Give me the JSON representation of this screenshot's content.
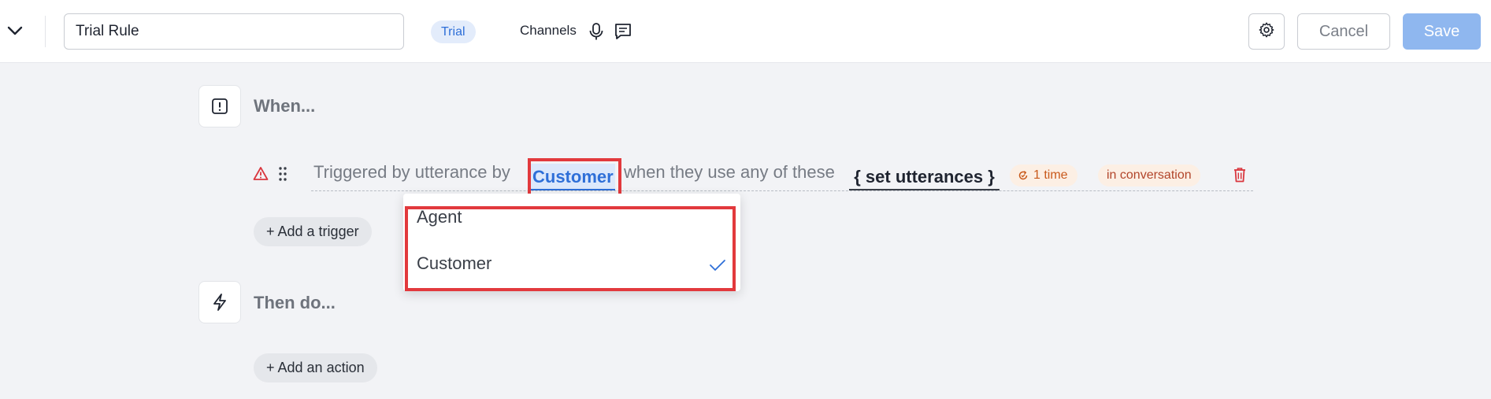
{
  "header": {
    "rule_name": "Trial Rule",
    "status_badge": "Trial",
    "channels_label": "Channels",
    "cancel_label": "Cancel",
    "save_label": "Save",
    "icons": [
      "chevron-down-icon",
      "microphone-icon",
      "chat-icon",
      "gear-icon"
    ]
  },
  "when_section": {
    "title": "When...",
    "icon": "alert-square-icon",
    "trigger": {
      "prefix": "Triggered by utterance by",
      "speaker": "Customer",
      "middle": "when they use any of these",
      "utterances": "{ set utterances }",
      "frequency": "1 time",
      "scope": "in conversation",
      "icons": [
        "warning-icon",
        "drag-handle-icon",
        "refresh-icon",
        "trash-icon"
      ]
    },
    "add_trigger_label": "+ Add a trigger"
  },
  "then_section": {
    "title": "Then do...",
    "icon": "lightning-icon",
    "add_action_label": "+ Add an action"
  },
  "speaker_dropdown": {
    "options": [
      "Agent",
      "Customer"
    ],
    "selected": "Customer"
  },
  "colors": {
    "accent": "#2e6fd8",
    "highlight": "#e2393d",
    "save_disabled": "#8fb7ef",
    "warning_badge_bg": "#fcefe4",
    "delete": "#d9363e"
  }
}
